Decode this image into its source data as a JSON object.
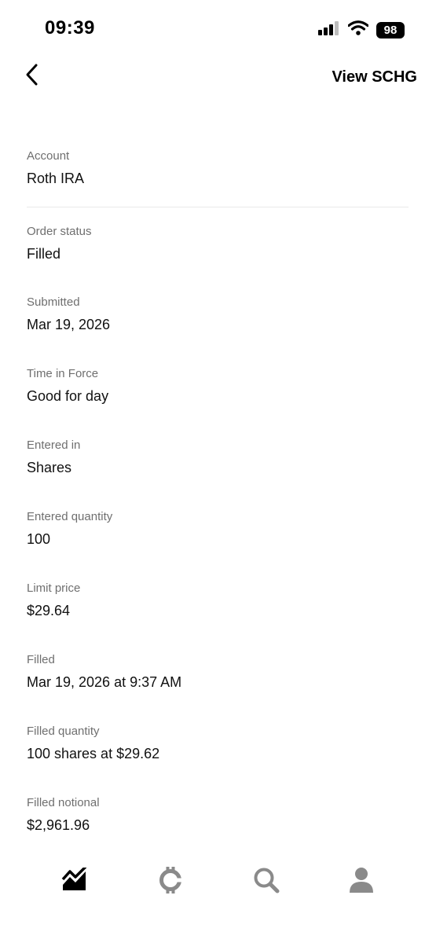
{
  "status_bar": {
    "time": "09:39",
    "battery": "98",
    "icons": [
      "cellular-signal-icon",
      "wifi-icon",
      "battery-icon"
    ]
  },
  "header": {
    "back_icon": "chevron-left-icon",
    "action_label": "View SCHG"
  },
  "details": [
    {
      "label": "Account",
      "value": "Roth IRA"
    },
    {
      "label": "Order status",
      "value": "Filled"
    },
    {
      "label": "Submitted",
      "value": "Mar 19, 2026"
    },
    {
      "label": "Time in Force",
      "value": "Good for day"
    },
    {
      "label": "Entered in",
      "value": "Shares"
    },
    {
      "label": "Entered quantity",
      "value": "100"
    },
    {
      "label": "Limit price",
      "value": "$29.64"
    },
    {
      "label": "Filled",
      "value": "Mar 19, 2026 at 9:37 AM"
    },
    {
      "label": "Filled quantity",
      "value": "100 shares at $29.62"
    },
    {
      "label": "Filled notional",
      "value": "$2,961.96"
    }
  ],
  "tab_bar": {
    "tabs": [
      {
        "icon": "investing-chart-icon",
        "active": true
      },
      {
        "icon": "crypto-icon",
        "active": false
      },
      {
        "icon": "search-icon",
        "active": false
      },
      {
        "icon": "profile-icon",
        "active": false
      }
    ],
    "active_color": "#000000",
    "inactive_color": "#8a8a8a"
  }
}
